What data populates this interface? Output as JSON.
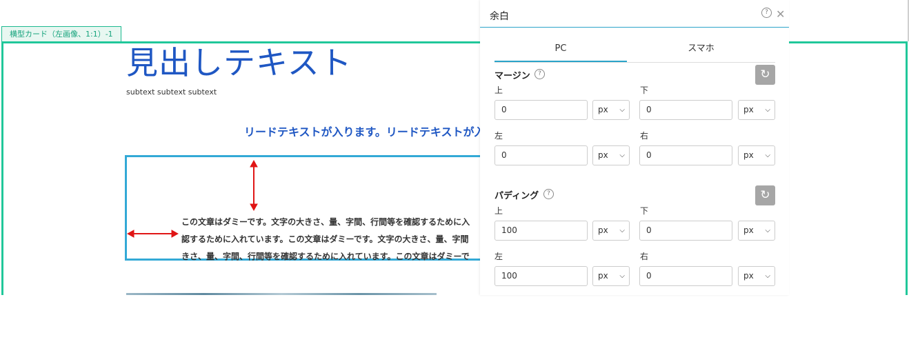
{
  "canvas": {
    "card_tag": "横型カード（左画像、1:1）-1",
    "heading": "見出しテキスト",
    "subtext": "subtext subtext subtext",
    "lead": "リードテキストが入ります。リードテキストが入",
    "body_lines": [
      "この文章はダミーです。文字の大きさ、量、字間、行間等を確認するために入",
      "認するために入れています。この文章はダミーです。文字の大きさ、量、字間",
      "きさ、量、字間、行間等を確認するために入れています。この文章はダミーで"
    ]
  },
  "panel": {
    "title": "余白",
    "tabs": [
      {
        "label": "PC",
        "active": true
      },
      {
        "label": "スマホ",
        "active": false
      }
    ],
    "margin": {
      "label": "マージン",
      "top": {
        "label": "上",
        "value": "0",
        "unit": "px"
      },
      "bottom": {
        "label": "下",
        "value": "0",
        "unit": "px"
      },
      "left": {
        "label": "左",
        "value": "0",
        "unit": "px"
      },
      "right": {
        "label": "右",
        "value": "0",
        "unit": "px"
      }
    },
    "padding": {
      "label": "パディング",
      "top": {
        "label": "上",
        "value": "100",
        "unit": "px"
      },
      "bottom": {
        "label": "下",
        "value": "0",
        "unit": "px"
      },
      "left": {
        "label": "左",
        "value": "100",
        "unit": "px"
      },
      "right": {
        "label": "右",
        "value": "0",
        "unit": "px"
      }
    },
    "icons": {
      "help": "?",
      "close": "✕",
      "reset": "↻",
      "chevron": "❯"
    }
  },
  "colors": {
    "accent": "#2aa3c9",
    "card_border": "#20c79a",
    "heading": "#1f57c3",
    "arrow": "#e01515"
  }
}
